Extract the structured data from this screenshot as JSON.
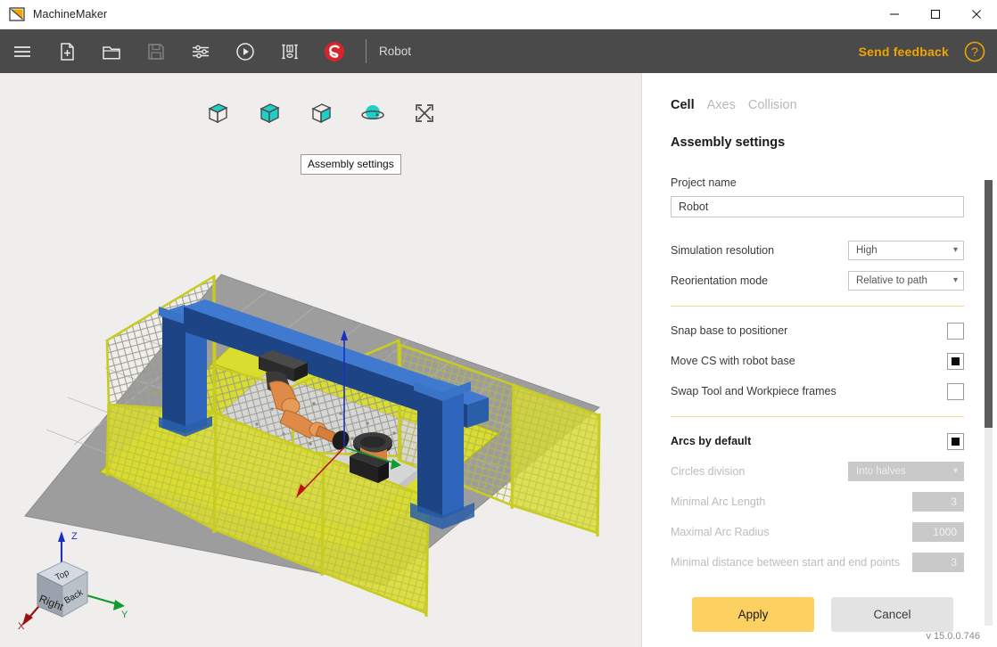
{
  "window": {
    "app_icon": "machinemaker-logo-icon",
    "title": "MachineMaker",
    "minimize_label": "—",
    "maximize_label": "□",
    "close_label": "✕"
  },
  "toolbar": {
    "items": [
      {
        "name": "menu-icon",
        "label": "Menu",
        "disabled": false
      },
      {
        "name": "new-file-icon",
        "label": "New",
        "disabled": false
      },
      {
        "name": "open-folder-icon",
        "label": "Open",
        "disabled": false
      },
      {
        "name": "save-icon",
        "label": "Save",
        "disabled": true
      },
      {
        "name": "settings-sliders-icon",
        "label": "Settings",
        "disabled": false
      },
      {
        "name": "play-icon",
        "label": "Simulate",
        "disabled": false
      },
      {
        "name": "measure-icon",
        "label": "Measure",
        "disabled": false
      },
      {
        "name": "swirl-logo-icon",
        "label": "Brand",
        "disabled": false
      }
    ],
    "project_name": "Robot",
    "send_feedback_label": "Send feedback",
    "help_icon": "help-circle-icon"
  },
  "viewport": {
    "tooltip": "Assembly settings",
    "tools": [
      {
        "name": "view-top-face-icon",
        "label": "Top face"
      },
      {
        "name": "view-front-face-icon",
        "label": "Front face"
      },
      {
        "name": "view-right-face-icon",
        "label": "Right face"
      },
      {
        "name": "view-orbit-icon",
        "label": "Assembly settings"
      },
      {
        "name": "fit-to-screen-icon",
        "label": "Fit to screen"
      }
    ],
    "navcube": {
      "face_top": "Top",
      "face_right": "Right",
      "face_back": "Back",
      "axis_x": "X",
      "axis_y": "Y",
      "axis_z": "Z"
    }
  },
  "panel": {
    "tabs": [
      {
        "label": "Cell",
        "active": true
      },
      {
        "label": "Axes",
        "active": false
      },
      {
        "label": "Collision",
        "active": false
      }
    ],
    "section_title": "Assembly settings",
    "project_name_label": "Project name",
    "project_name_value": "Robot",
    "simulation_resolution": {
      "label": "Simulation resolution",
      "value": "High"
    },
    "reorientation_mode": {
      "label": "Reorientation mode",
      "value": "Relative to path"
    },
    "checkboxes": [
      {
        "label": "Snap base to positioner",
        "checked": false,
        "disabled": false,
        "bold": false
      },
      {
        "label": "Move CS with robot base",
        "checked": true,
        "disabled": false,
        "bold": false
      },
      {
        "label": "Swap Tool and Workpiece frames",
        "checked": false,
        "disabled": false,
        "bold": false
      }
    ],
    "arcs_by_default": {
      "label": "Arcs by default",
      "checked": true
    },
    "circles_division": {
      "label": "Circles division",
      "value": "Into halves",
      "disabled": true
    },
    "minimal_arc_length": {
      "label": "Minimal Arc Length",
      "value": "3",
      "disabled": true
    },
    "maximal_arc_radius": {
      "label": "Maximal Arc Radius",
      "value": "1000",
      "disabled": true
    },
    "minimal_distance": {
      "label": "Minimal distance between start and end points",
      "value": "3",
      "disabled": true
    },
    "apply_label": "Apply",
    "cancel_label": "Cancel",
    "version": "v 15.0.0.746"
  },
  "colors": {
    "accent": "#f0a500",
    "apply_button": "#fcd162",
    "toolbar_bg": "#4a4a4a",
    "viewport_bg": "#efeeec",
    "fence_yellow": "#d8d800",
    "gantry_blue": "#23559e",
    "robot_orange": "#e08040",
    "cyan_icon": "#20d0c8"
  }
}
